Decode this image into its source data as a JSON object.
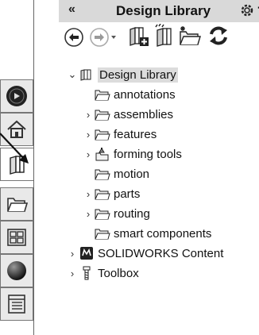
{
  "header": {
    "collapse_glyph": "«",
    "title": "Design Library",
    "options_icon": "gear-icon",
    "add_glyph": "+"
  },
  "toolbar": {
    "buttons": [
      {
        "name": "back-button",
        "icon": "back-arrow-icon"
      },
      {
        "name": "forward-button",
        "icon": "forward-arrow-icon"
      },
      {
        "name": "add-to-library-button",
        "icon": "add-to-library-icon"
      },
      {
        "name": "add-file-location-button",
        "icon": "add-file-location-icon"
      },
      {
        "name": "create-new-folder-button",
        "icon": "new-folder-icon"
      },
      {
        "name": "refresh-button",
        "icon": "refresh-icon"
      }
    ]
  },
  "left_tabs": [
    {
      "name": "solidworks-resources-tab",
      "icon": "resources-icon"
    },
    {
      "name": "home-tab",
      "icon": "home-icon"
    },
    {
      "name": "design-library-tab",
      "icon": "design-library-icon",
      "active": true
    },
    {
      "name": "file-explorer-tab",
      "icon": "folder-icon"
    },
    {
      "name": "view-palette-tab",
      "icon": "view-palette-icon"
    },
    {
      "name": "appearances-tab",
      "icon": "appearances-icon"
    },
    {
      "name": "custom-properties-tab",
      "icon": "custom-properties-icon"
    }
  ],
  "tree": {
    "root": "Design Library",
    "items": [
      {
        "label": "annotations",
        "expandable": false
      },
      {
        "label": "assemblies",
        "expandable": true
      },
      {
        "label": "features",
        "expandable": true
      },
      {
        "label": "forming tools",
        "expandable": true
      },
      {
        "label": "motion",
        "expandable": false
      },
      {
        "label": "parts",
        "expandable": true
      },
      {
        "label": "routing",
        "expandable": true
      },
      {
        "label": "smart components",
        "expandable": false
      }
    ],
    "other_roots": [
      {
        "label": "SOLIDWORKS Content",
        "icon": "solidworks-content-icon"
      },
      {
        "label": "Toolbox",
        "icon": "toolbox-icon"
      }
    ]
  },
  "expand_glyph": "›",
  "expanded_glyph": "⌄",
  "colors": {
    "header_bg": "#d9d9d9",
    "tab_bg": "#e9e9e9",
    "selected_bg": "#dcdcdc"
  }
}
